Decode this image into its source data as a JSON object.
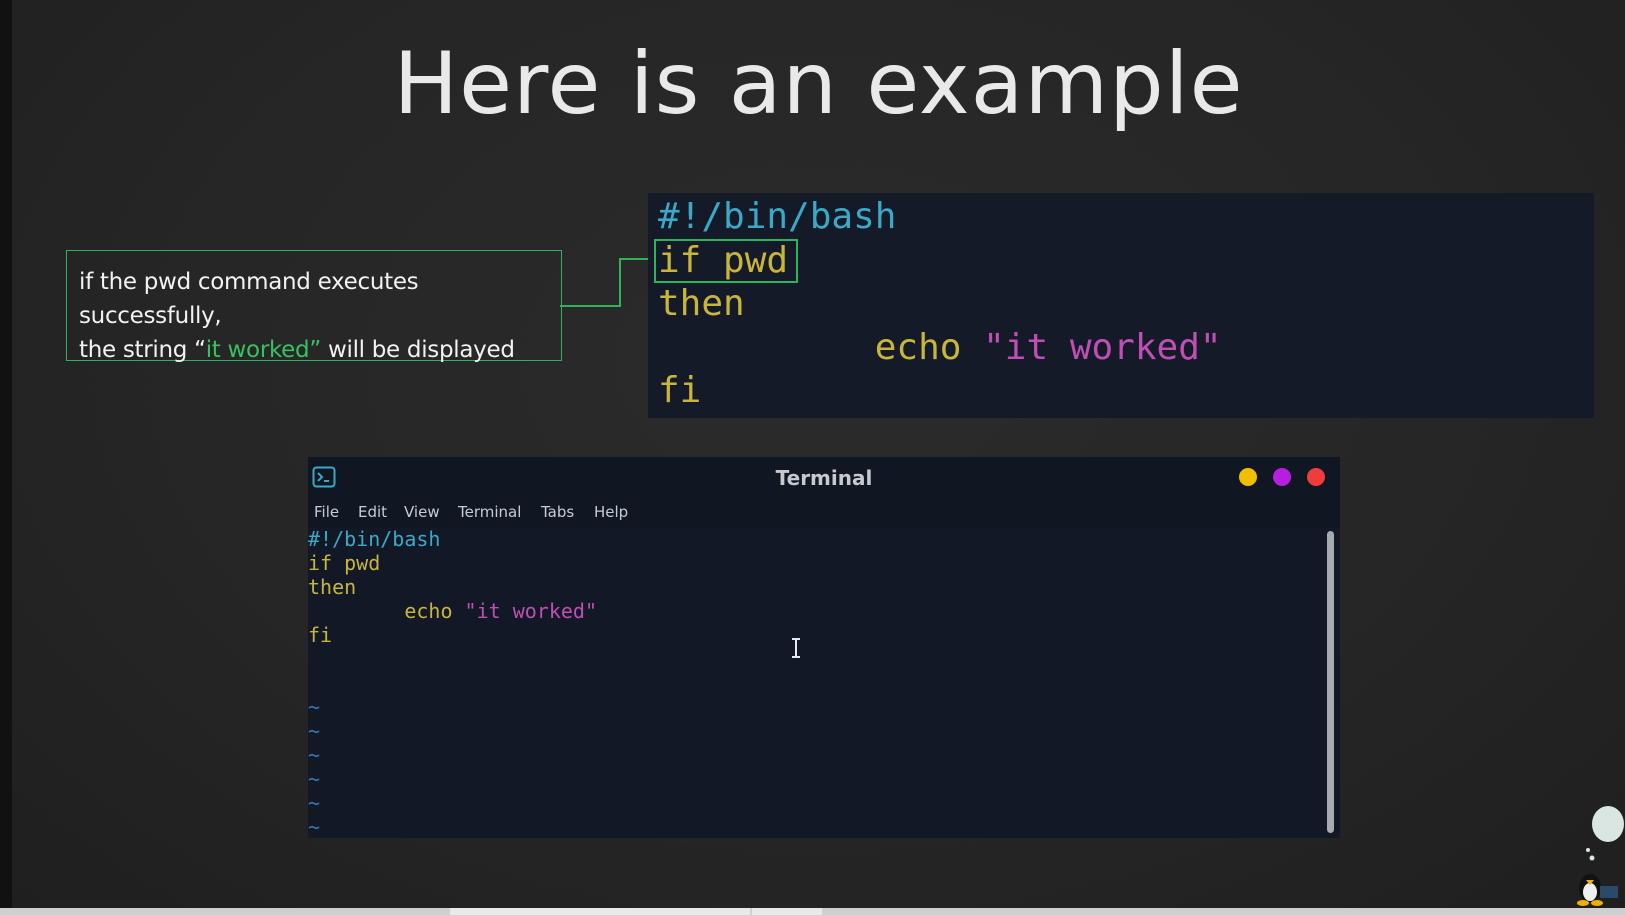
{
  "slide": {
    "title": "Here is an example"
  },
  "callout": {
    "line1": "if the pwd command executes successfully,",
    "line2_before": "the string “",
    "line2_highlight": "it worked”",
    "line2_after": " will be displayed"
  },
  "code_panel": {
    "shebang": "#!/bin/bash",
    "if_line": "if pwd",
    "then_line": "then",
    "echo_indent": "          ",
    "echo_cmd": "echo ",
    "echo_arg": "\"it worked\"",
    "fi_line": "fi"
  },
  "terminal": {
    "title": "Terminal",
    "menu": [
      "File",
      "Edit",
      "View",
      "Terminal",
      "Tabs",
      "Help"
    ],
    "lines": {
      "shebang": "#!/bin/bash",
      "if_line": "if pwd",
      "then_line": "then",
      "echo_indent": "        ",
      "echo_cmd": "echo ",
      "echo_arg": "\"it worked\"",
      "fi_line": "fi",
      "tilde": "~"
    },
    "buttons": {
      "minimize_color": "#f0c000",
      "maximize_color": "#b81ee0",
      "close_color": "#f03c3c"
    }
  },
  "colors": {
    "accent_green": "#2fb35a",
    "code_cyan": "#3aa9c7",
    "code_yellow": "#c9b53a",
    "code_magenta": "#c04fb5"
  },
  "icons": [
    "terminal-app-icon",
    "text-cursor-icon",
    "tux-mascot-icon"
  ]
}
